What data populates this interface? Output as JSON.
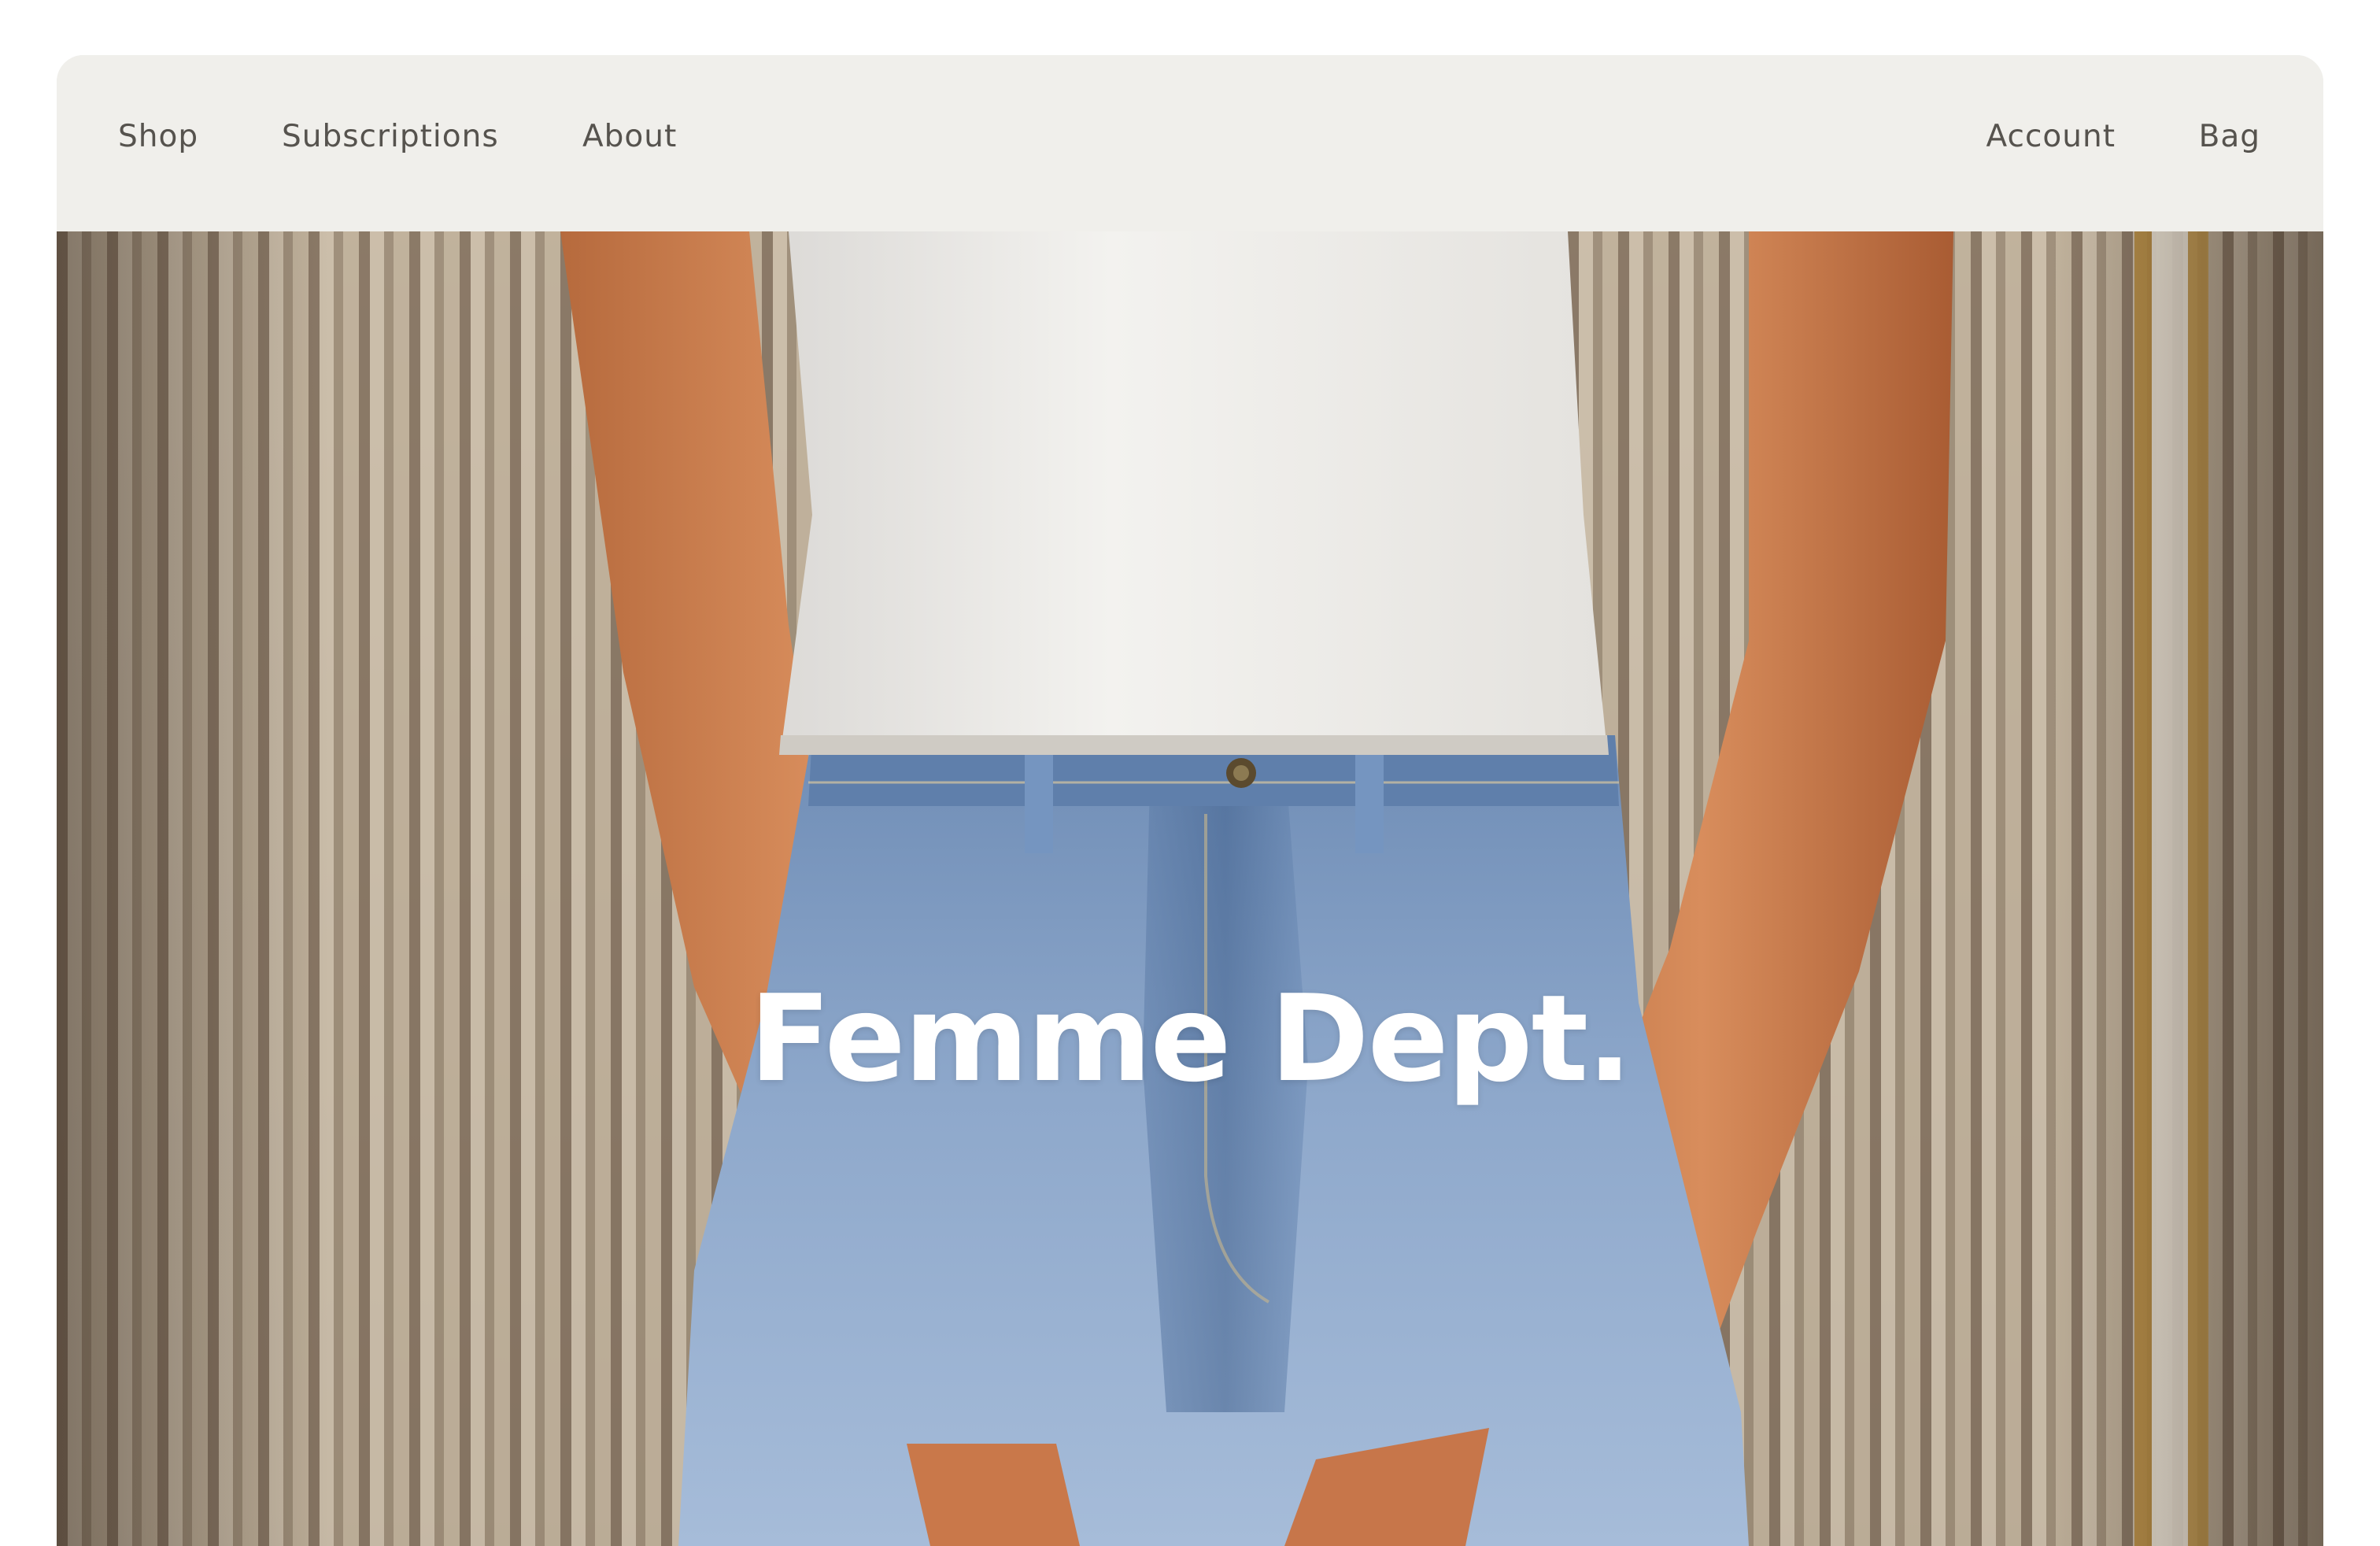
{
  "nav": {
    "left": [
      {
        "label": "Shop"
      },
      {
        "label": "Subscriptions"
      },
      {
        "label": "About"
      }
    ],
    "right": [
      {
        "label": "Account"
      },
      {
        "label": "Bag"
      }
    ]
  },
  "hero": {
    "title": "Femme Dept.",
    "image_alt": "Person in white ribbed crop top and light-wash high-waist jeans standing before beige curtains"
  },
  "colors": {
    "nav_background": "#f0efeb",
    "nav_text": "#56534e",
    "hero_title": "#ffffff",
    "page_background": "#ffffff"
  }
}
